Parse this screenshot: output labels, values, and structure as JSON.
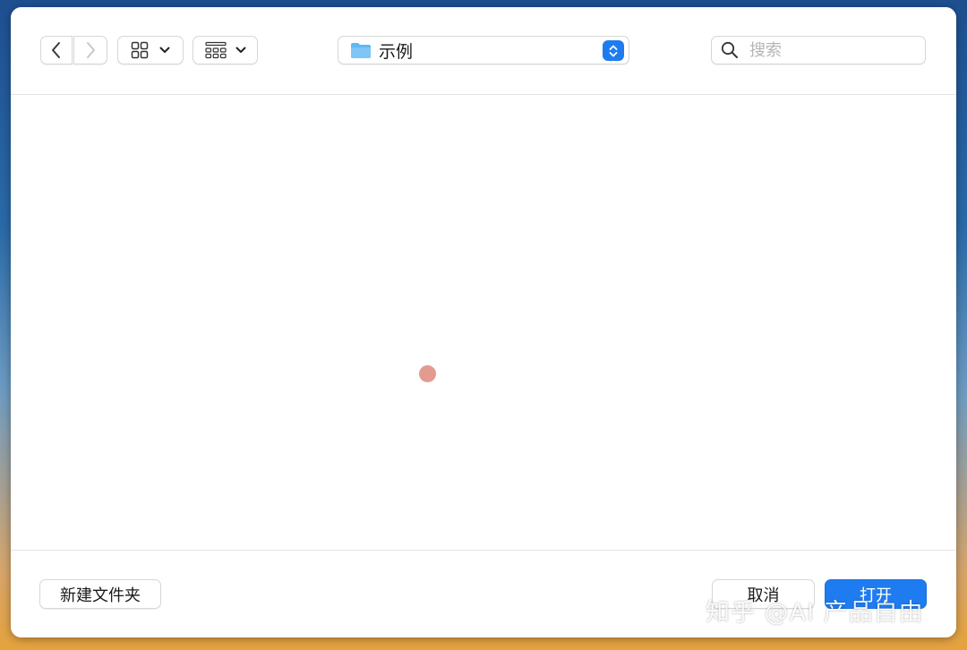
{
  "toolbar": {
    "location_label": "示例",
    "search_placeholder": "搜索"
  },
  "footer": {
    "new_folder_label": "新建文件夹",
    "cancel_label": "取消",
    "open_label": "打开"
  },
  "watermark": "知乎 @AI 产品自由",
  "icons": {
    "back": "chevron-left-icon",
    "forward": "chevron-right-icon",
    "view": "grid-view-icon",
    "group": "group-icon",
    "folder": "folder-icon",
    "updown": "updown-chevron-icon",
    "search": "search-icon"
  },
  "colors": {
    "accent": "#1f7cf0",
    "folder": "#5fb7f5",
    "cursor": "#e39a8f"
  }
}
